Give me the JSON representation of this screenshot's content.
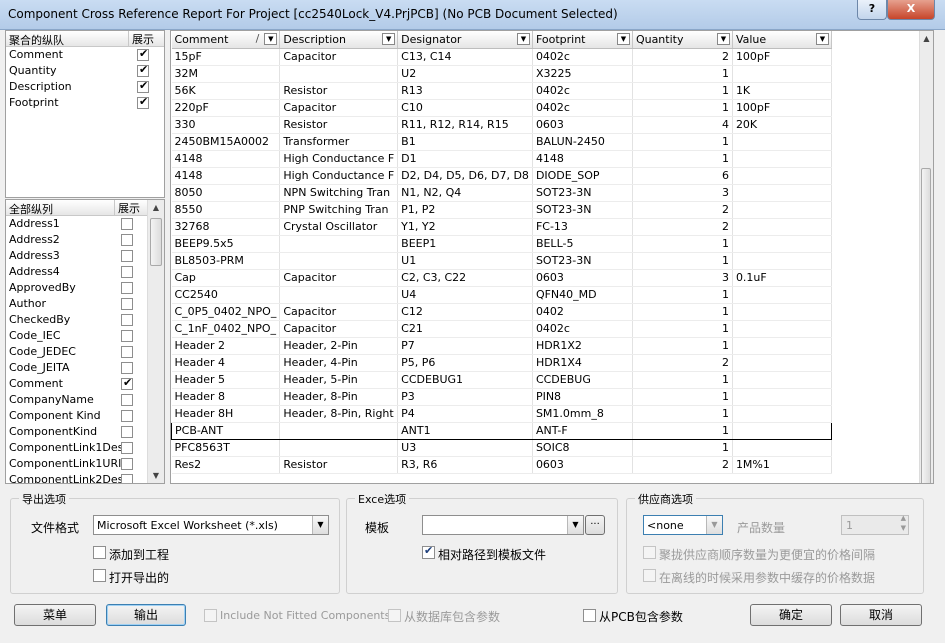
{
  "window": {
    "title": "Component Cross Reference Report For Project [cc2540Lock_V4.PrjPCB] (No PCB Document Selected)",
    "help_label": "?",
    "close_label": "X"
  },
  "grouped_columns": {
    "header": {
      "name": "聚合的纵队",
      "show": "展示"
    },
    "items": [
      {
        "label": "Comment",
        "checked": true
      },
      {
        "label": "Quantity",
        "checked": true
      },
      {
        "label": "Description",
        "checked": true
      },
      {
        "label": "Footprint",
        "checked": true
      }
    ]
  },
  "all_columns": {
    "header": {
      "name": "全部纵列",
      "show": "展示"
    },
    "items": [
      {
        "label": "Address1",
        "checked": false
      },
      {
        "label": "Address2",
        "checked": false
      },
      {
        "label": "Address3",
        "checked": false
      },
      {
        "label": "Address4",
        "checked": false
      },
      {
        "label": "ApprovedBy",
        "checked": false
      },
      {
        "label": "Author",
        "checked": false
      },
      {
        "label": "CheckedBy",
        "checked": false
      },
      {
        "label": "Code_IEC",
        "checked": false
      },
      {
        "label": "Code_JEDEC",
        "checked": false
      },
      {
        "label": "Code_JEITA",
        "checked": false
      },
      {
        "label": "Comment",
        "checked": true
      },
      {
        "label": "CompanyName",
        "checked": false
      },
      {
        "label": "Component Kind",
        "checked": false
      },
      {
        "label": "ComponentKind",
        "checked": false
      },
      {
        "label": "ComponentLink1Des",
        "checked": false
      },
      {
        "label": "ComponentLink1URI",
        "checked": false
      },
      {
        "label": "ComponentLink2Des",
        "checked": false
      }
    ]
  },
  "bom_table": {
    "columns": [
      "Comment",
      "Description",
      "Designator",
      "Footprint",
      "Quantity",
      "Value"
    ],
    "sort_indicator": "/",
    "rows": [
      [
        "15pF",
        "Capacitor",
        "C13, C14",
        "0402c",
        "2",
        "100pF"
      ],
      [
        "32M",
        "",
        "U2",
        "X3225",
        "1",
        ""
      ],
      [
        "56K",
        "Resistor",
        "R13",
        "0402c",
        "1",
        "1K"
      ],
      [
        "220pF",
        "Capacitor",
        "C10",
        "0402c",
        "1",
        "100pF"
      ],
      [
        "330",
        "Resistor",
        "R11, R12, R14, R15",
        "0603",
        "4",
        "20K"
      ],
      [
        "2450BM15A0002",
        "Transformer",
        "B1",
        "BALUN-2450",
        "1",
        ""
      ],
      [
        "4148",
        "High Conductance F",
        "D1",
        "4148",
        "1",
        ""
      ],
      [
        "4148",
        "High Conductance F",
        "D2, D4, D5, D6, D7, D8",
        "DIODE_SOP",
        "6",
        ""
      ],
      [
        "8050",
        "NPN Switching Tran",
        "N1, N2, Q4",
        "SOT23-3N",
        "3",
        ""
      ],
      [
        "8550",
        "PNP Switching Tran",
        "P1, P2",
        "SOT23-3N",
        "2",
        ""
      ],
      [
        "32768",
        "Crystal Oscillator",
        "Y1, Y2",
        "FC-13",
        "2",
        ""
      ],
      [
        "BEEP9.5x5",
        "",
        "BEEP1",
        "BELL-5",
        "1",
        ""
      ],
      [
        "BL8503-PRM",
        "",
        "U1",
        "SOT23-3N",
        "1",
        ""
      ],
      [
        "Cap",
        "Capacitor",
        "C2, C3, C22",
        "0603",
        "3",
        "0.1uF"
      ],
      [
        "CC2540",
        "",
        "U4",
        "QFN40_MD",
        "1",
        ""
      ],
      [
        "C_0P5_0402_NPO_",
        "Capacitor",
        "C12",
        "0402",
        "1",
        ""
      ],
      [
        "C_1nF_0402_NPO_",
        "Capacitor",
        "C21",
        "0402c",
        "1",
        ""
      ],
      [
        "Header 2",
        "Header, 2-Pin",
        "P7",
        "HDR1X2",
        "1",
        ""
      ],
      [
        "Header 4",
        "Header, 4-Pin",
        "P5, P6",
        "HDR1X4",
        "2",
        ""
      ],
      [
        "Header 5",
        "Header, 5-Pin",
        "CCDEBUG1",
        "CCDEBUG",
        "1",
        ""
      ],
      [
        "Header 8",
        "Header, 8-Pin",
        "P3",
        "PIN8",
        "1",
        ""
      ],
      [
        "Header 8H",
        "Header, 8-Pin, Right",
        "P4",
        "SM1.0mm_8",
        "1",
        ""
      ],
      [
        "PCB-ANT",
        "",
        "ANT1",
        "ANT-F",
        "1",
        ""
      ],
      [
        "PFC8563T",
        "",
        "U3",
        "SOIC8",
        "1",
        ""
      ],
      [
        "Res2",
        "Resistor",
        "R3, R6",
        "0603",
        "2",
        "1M%1"
      ]
    ],
    "selected_row": 22
  },
  "export": {
    "group_label": "导出选项",
    "format_label": "文件格式",
    "format_value": "Microsoft Excel Worksheet (*.xls)",
    "add_to_project": "添加到工程",
    "open_exported": "打开导出的"
  },
  "excel": {
    "group_label": "Exce选项",
    "template_label": "模板",
    "template_value": "",
    "browse_label": "···",
    "relative_path": "相对路径到模板文件"
  },
  "supplier": {
    "group_label": "供应商选项",
    "supplier_value": "<none",
    "qty_label": "产品数量",
    "qty_value": "1",
    "opt1": "聚拢供应商顺序数量为更便宜的价格间隔",
    "opt2": "在离线的时候采用参数中缓存的价格数据"
  },
  "footer": {
    "menu": "菜单",
    "output": "输出",
    "include_not_fitted": "Include Not Fitted Components",
    "from_db": "从数据库包含参数",
    "from_pcb": "从PCB包含参数",
    "ok": "确定",
    "cancel": "取消"
  }
}
